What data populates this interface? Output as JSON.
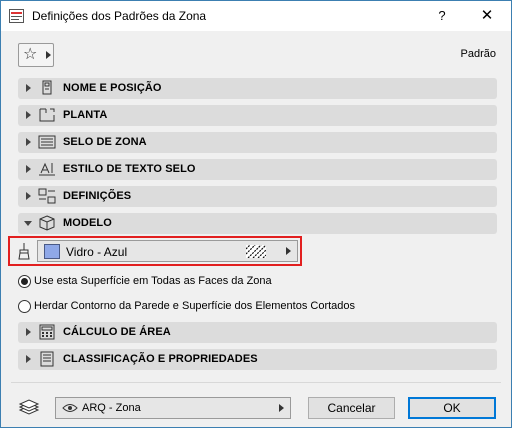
{
  "window": {
    "title": "Definições dos Padrões da Zona",
    "help_label": "?",
    "close_label": "✕"
  },
  "header": {
    "favorites_icon": "star-icon",
    "preset_label": "Padrão"
  },
  "sections": [
    {
      "label": "NOME E POSIÇÃO",
      "icon": "name-tag-icon",
      "expanded": false
    },
    {
      "label": "PLANTA",
      "icon": "floor-plan-icon",
      "expanded": false
    },
    {
      "label": "SELO DE ZONA",
      "icon": "zone-stamp-icon",
      "expanded": false
    },
    {
      "label": "ESTILO DE TEXTO SELO",
      "icon": "text-style-icon",
      "expanded": false
    },
    {
      "label": "DEFINIÇÕES",
      "icon": "settings-icon",
      "expanded": false
    },
    {
      "label": "MODELO",
      "icon": "3d-box-icon",
      "expanded": true
    },
    {
      "label": "CÁLCULO DE ÁREA",
      "icon": "area-calculator-icon",
      "expanded": false
    },
    {
      "label": "CLASSIFICAÇÃO E PROPRIEDADES",
      "icon": "classification-icon",
      "expanded": false
    }
  ],
  "model": {
    "surface_name": "Vidro - Azul",
    "surface_color": "#8fa8e8",
    "highlight_color": "#e21f1f",
    "options": [
      {
        "label": "Use esta Superfície em Todas as Faces da Zona",
        "selected": true
      },
      {
        "label": "Herdar Contorno da Parede e  Superfície dos Elementos Cortados",
        "selected": false
      }
    ]
  },
  "footer": {
    "layer_name": "ARQ - Zona",
    "cancel_label": "Cancelar",
    "ok_label": "OK",
    "default_button_color": "#0078d7"
  }
}
